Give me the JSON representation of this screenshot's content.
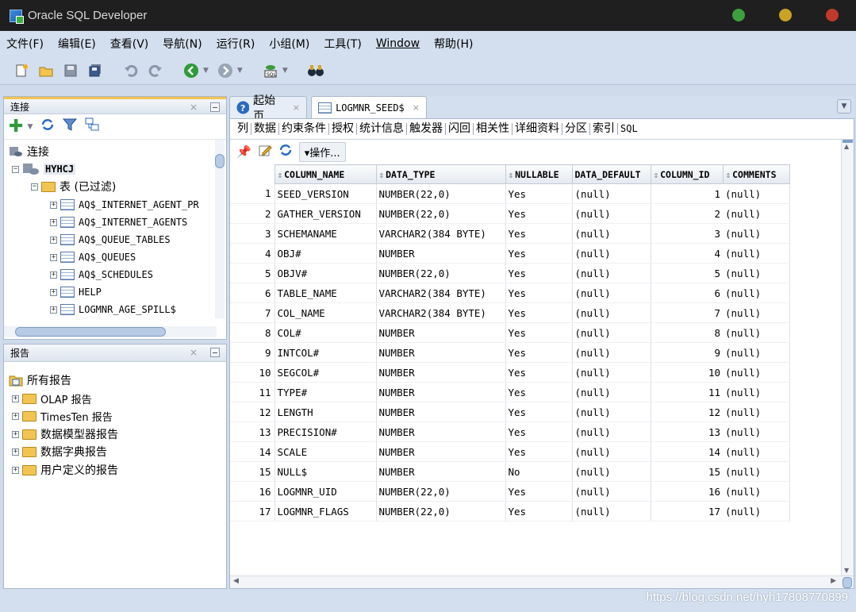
{
  "window": {
    "title": "Oracle SQL Developer",
    "controls": {
      "minimize_color": "#3e9f3e",
      "maximize_color": "#c9a227",
      "close_color": "#c0392b"
    }
  },
  "menu": [
    "文件(F)",
    "编辑(E)",
    "查看(V)",
    "导航(N)",
    "运行(R)",
    "小组(M)",
    "工具(T)",
    "Window",
    "帮助(H)"
  ],
  "toolbar": {
    "icons": [
      "new-icon",
      "open-icon",
      "save-icon",
      "save-all-icon",
      "undo-icon",
      "redo-icon",
      "back-icon",
      "forward-icon",
      "sql-worksheet-icon",
      "binoculars-icon"
    ]
  },
  "connections_panel": {
    "title": "连接",
    "root_label": "连接",
    "connection_name": "HYHCJ",
    "tables_node": "表 (已过滤)",
    "tables": [
      "AQ$_INTERNET_AGENT_PR",
      "AQ$_INTERNET_AGENTS",
      "AQ$_QUEUE_TABLES",
      "AQ$_QUEUES",
      "AQ$_SCHEDULES",
      "HELP",
      "LOGMNR_AGE_SPILL$"
    ]
  },
  "reports_panel": {
    "title": "报告",
    "root_label": "所有报告",
    "items": [
      "OLAP 报告",
      "TimesTen 报告",
      "数据模型器报告",
      "数据字典报告",
      "用户定义的报告"
    ]
  },
  "tabs": [
    {
      "label": "起始页",
      "active": false
    },
    {
      "label": "LOGMNR_SEED$",
      "active": true
    }
  ],
  "subtabs": [
    "列",
    "数据",
    "约束条件",
    "授权",
    "统计信息",
    "触发器",
    "闪回",
    "相关性",
    "详细资料",
    "分区",
    "索引",
    "SQL"
  ],
  "actions_label": "▾操作...",
  "grid": {
    "columns": [
      "COLUMN_NAME",
      "DATA_TYPE",
      "NULLABLE",
      "DATA_DEFAULT",
      "COLUMN_ID",
      "COMMENTS"
    ],
    "rows": [
      [
        "1",
        "SEED_VERSION",
        "NUMBER(22,0)",
        "Yes",
        "(null)",
        "1",
        "(null)"
      ],
      [
        "2",
        "GATHER_VERSION",
        "NUMBER(22,0)",
        "Yes",
        "(null)",
        "2",
        "(null)"
      ],
      [
        "3",
        "SCHEMANAME",
        "VARCHAR2(384 BYTE)",
        "Yes",
        "(null)",
        "3",
        "(null)"
      ],
      [
        "4",
        "OBJ#",
        "NUMBER",
        "Yes",
        "(null)",
        "4",
        "(null)"
      ],
      [
        "5",
        "OBJV#",
        "NUMBER(22,0)",
        "Yes",
        "(null)",
        "5",
        "(null)"
      ],
      [
        "6",
        "TABLE_NAME",
        "VARCHAR2(384 BYTE)",
        "Yes",
        "(null)",
        "6",
        "(null)"
      ],
      [
        "7",
        "COL_NAME",
        "VARCHAR2(384 BYTE)",
        "Yes",
        "(null)",
        "7",
        "(null)"
      ],
      [
        "8",
        "COL#",
        "NUMBER",
        "Yes",
        "(null)",
        "8",
        "(null)"
      ],
      [
        "9",
        "INTCOL#",
        "NUMBER",
        "Yes",
        "(null)",
        "9",
        "(null)"
      ],
      [
        "10",
        "SEGCOL#",
        "NUMBER",
        "Yes",
        "(null)",
        "10",
        "(null)"
      ],
      [
        "11",
        "TYPE#",
        "NUMBER",
        "Yes",
        "(null)",
        "11",
        "(null)"
      ],
      [
        "12",
        "LENGTH",
        "NUMBER",
        "Yes",
        "(null)",
        "12",
        "(null)"
      ],
      [
        "13",
        "PRECISION#",
        "NUMBER",
        "Yes",
        "(null)",
        "13",
        "(null)"
      ],
      [
        "14",
        "SCALE",
        "NUMBER",
        "Yes",
        "(null)",
        "14",
        "(null)"
      ],
      [
        "15",
        "NULL$",
        "NUMBER",
        "No",
        "(null)",
        "15",
        "(null)"
      ],
      [
        "16",
        "LOGMNR_UID",
        "NUMBER(22,0)",
        "Yes",
        "(null)",
        "16",
        "(null)"
      ],
      [
        "17",
        "LOGMNR_FLAGS",
        "NUMBER(22,0)",
        "Yes",
        "(null)",
        "17",
        "(null)"
      ]
    ]
  },
  "watermark": "https://blog.csdn.net/hyh17808770899"
}
